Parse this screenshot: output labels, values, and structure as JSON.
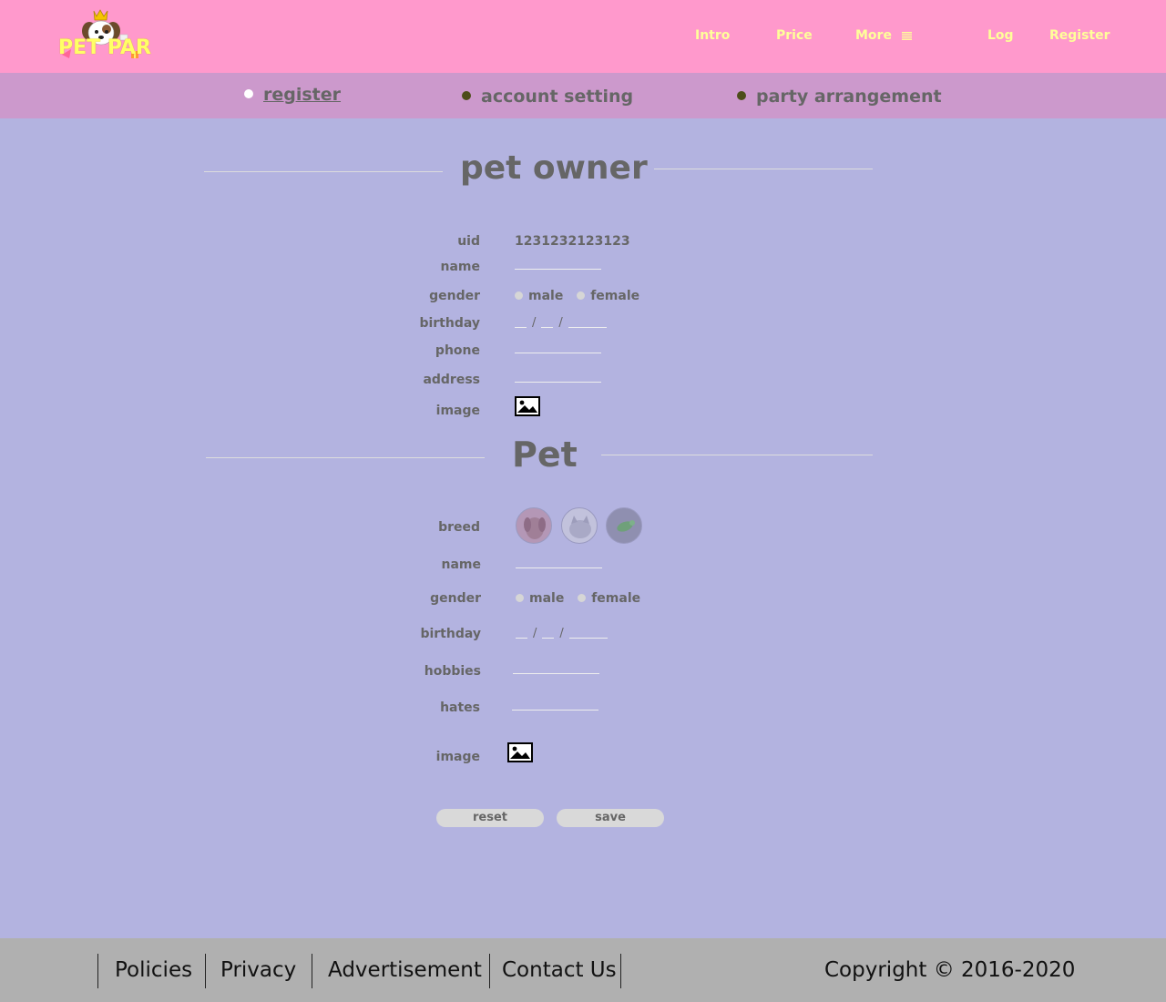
{
  "header": {
    "logo_text": "PET PAR",
    "nav": {
      "intro": "Intro",
      "price": "Price",
      "more": "More",
      "log": "Log",
      "register": "Register"
    }
  },
  "subnav": {
    "items": [
      {
        "label": "register",
        "active": true
      },
      {
        "label": "account setting",
        "active": false
      },
      {
        "label": "party arrangement",
        "active": false
      }
    ]
  },
  "owner": {
    "title": "pet owner",
    "labels": {
      "uid": "uid",
      "name": "name",
      "gender": "gender",
      "birthday": "birthday",
      "phone": "phone",
      "address": "address",
      "image": "image"
    },
    "uid_value": "1231232123123",
    "gender_options": [
      "male",
      "female"
    ]
  },
  "pet": {
    "title": "Pet",
    "labels": {
      "breed": "breed",
      "name": "name",
      "gender": "gender",
      "birthday": "birthday",
      "hobbies": "hobbies",
      "hates": "hates",
      "image": "image"
    },
    "breeds": [
      "dog",
      "cat",
      "bird"
    ],
    "gender_options": [
      "male",
      "female"
    ]
  },
  "buttons": {
    "reset": "reset",
    "save": "save"
  },
  "footer": {
    "links": [
      "Policies",
      "Privacy",
      "Advertisement",
      "Contact Us"
    ],
    "copyright": "Copyright  © 2016-2020"
  },
  "colors": {
    "header_bg": "#ff99cc",
    "subnav_bg": "#cc99cc",
    "page_bg": "#b3b3e0",
    "footer_bg": "#b0b0b0",
    "nav_text": "#ffff99",
    "label_text": "#666666"
  }
}
